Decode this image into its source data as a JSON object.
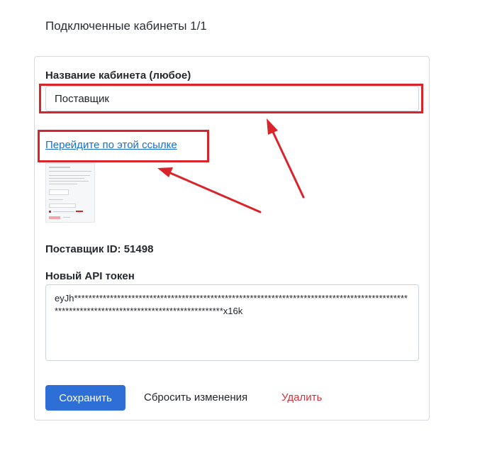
{
  "header": {
    "title": "Подключенные кабинеты 1/1"
  },
  "form": {
    "name_label": "Название кабинета (любое)",
    "name_value": "Поставщик",
    "link_text": "Перейдите по этой ссылке",
    "supplier_id": "Поставщик ID: 51498",
    "token_label": "Новый API токен",
    "token_value": "eyJh********************************************************************************************************************************************x16k"
  },
  "actions": {
    "save_label": "Сохранить",
    "reset_label": "Сбросить изменения",
    "delete_label": "Удалить"
  },
  "colors": {
    "accent": "#2d6fd6",
    "danger": "#d6303c",
    "link": "#1a6fc8",
    "annotation": "#d9242c"
  }
}
